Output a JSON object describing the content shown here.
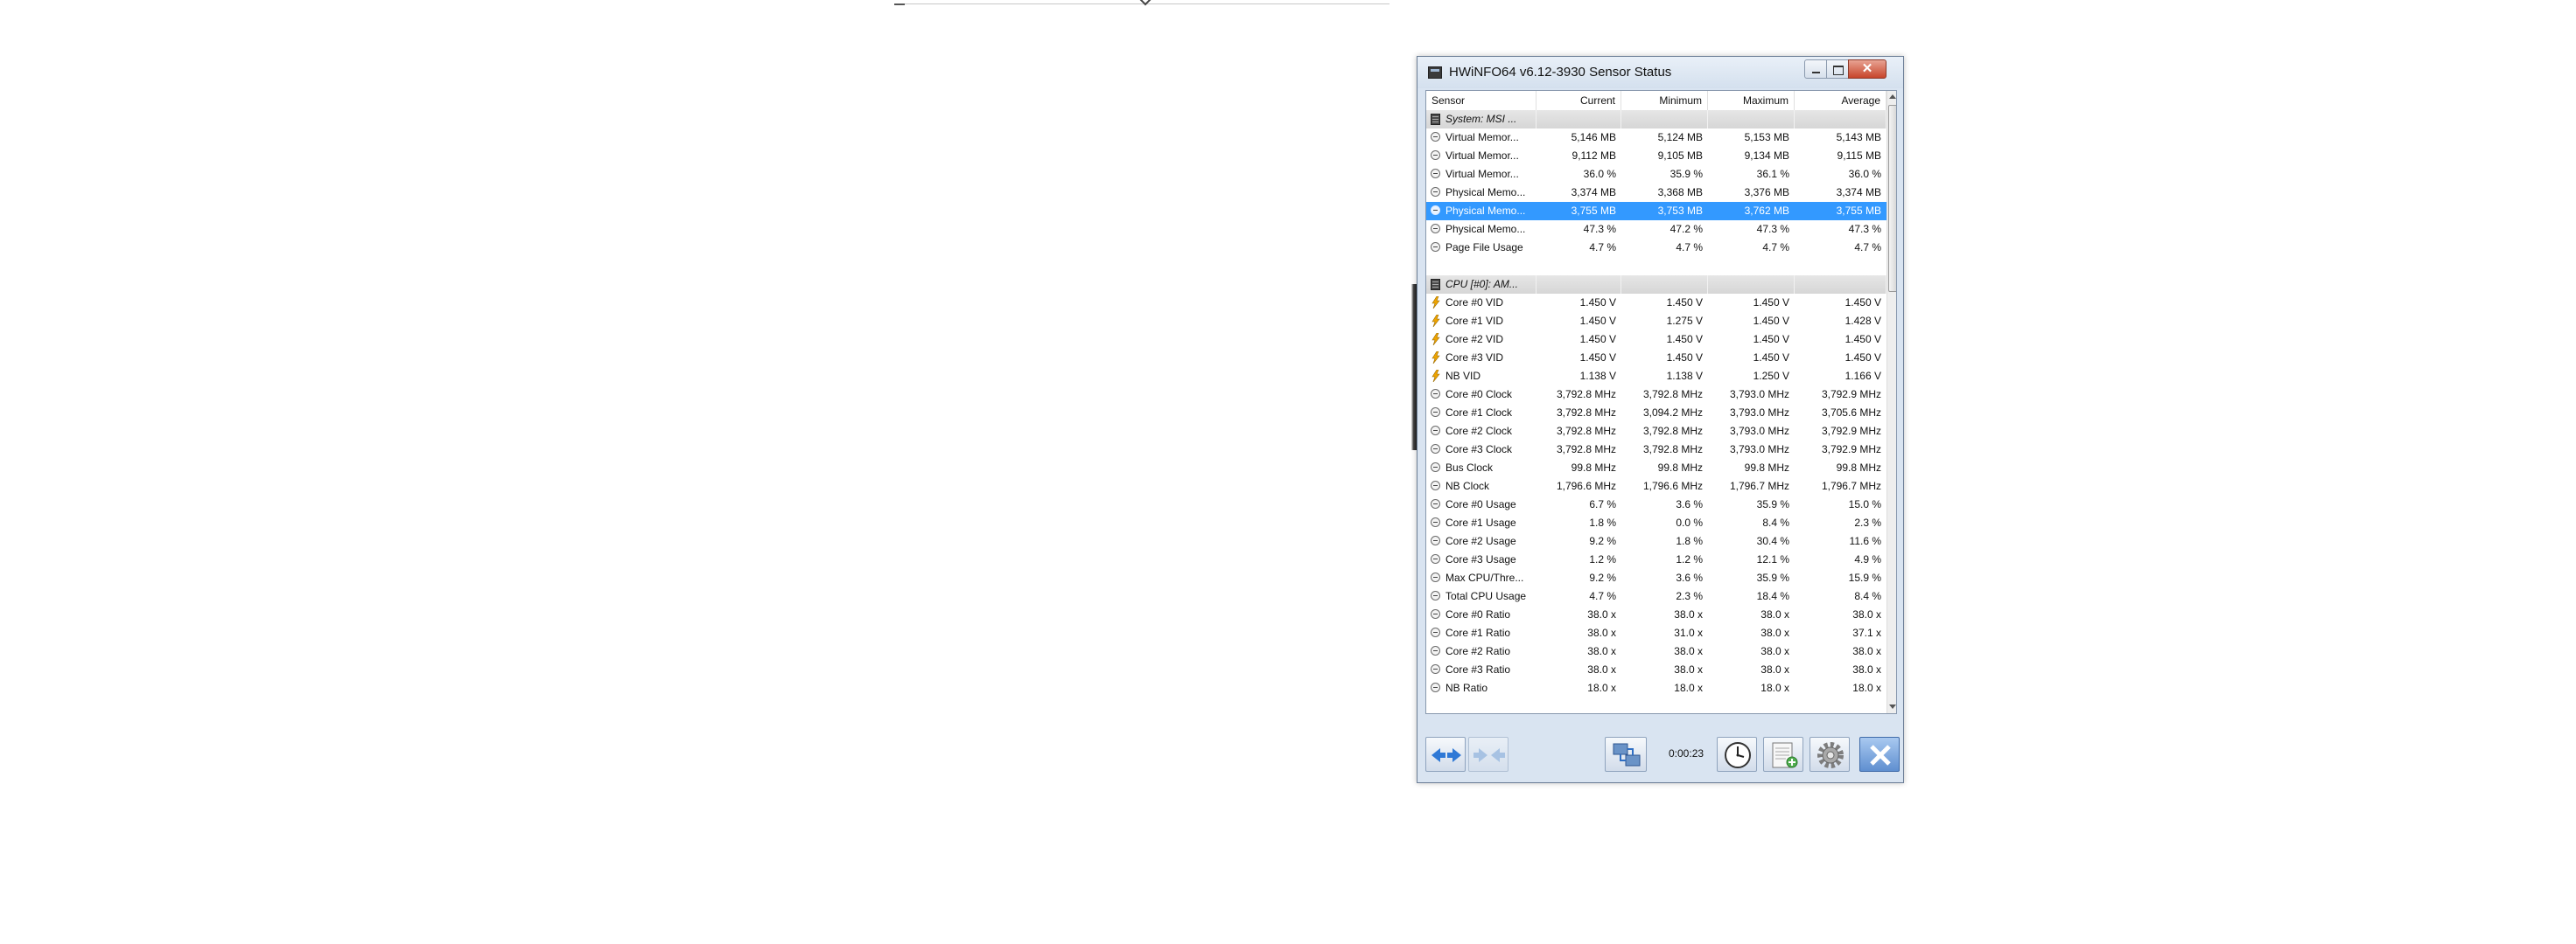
{
  "window": {
    "title": "HWiNFO64 v6.12-3930 Sensor Status"
  },
  "columns": {
    "sensor": "Sensor",
    "current": "Current",
    "minimum": "Minimum",
    "maximum": "Maximum",
    "average": "Average"
  },
  "rows": [
    {
      "type": "group",
      "name": "System: MSI ...",
      "icon": "chip-icon"
    },
    {
      "type": "data",
      "icon": "minus-icon",
      "name": "Virtual Memor...",
      "current": "5,146 MB",
      "minimum": "5,124 MB",
      "maximum": "5,153 MB",
      "average": "5,143 MB"
    },
    {
      "type": "data",
      "icon": "minus-icon",
      "name": "Virtual Memor...",
      "current": "9,112 MB",
      "minimum": "9,105 MB",
      "maximum": "9,134 MB",
      "average": "9,115 MB"
    },
    {
      "type": "data",
      "icon": "minus-icon",
      "name": "Virtual Memor...",
      "current": "36.0 %",
      "minimum": "35.9 %",
      "maximum": "36.1 %",
      "average": "36.0 %"
    },
    {
      "type": "data",
      "icon": "minus-icon",
      "name": "Physical Memo...",
      "current": "3,374 MB",
      "minimum": "3,368 MB",
      "maximum": "3,376 MB",
      "average": "3,374 MB"
    },
    {
      "type": "data",
      "icon": "minus-icon",
      "name": "Physical Memo...",
      "current": "3,755 MB",
      "minimum": "3,753 MB",
      "maximum": "3,762 MB",
      "average": "3,755 MB",
      "selected": true
    },
    {
      "type": "data",
      "icon": "minus-icon",
      "name": "Physical Memo...",
      "current": "47.3 %",
      "minimum": "47.2 %",
      "maximum": "47.3 %",
      "average": "47.3 %"
    },
    {
      "type": "data",
      "icon": "minus-icon",
      "name": "Page File Usage",
      "current": "4.7 %",
      "minimum": "4.7 %",
      "maximum": "4.7 %",
      "average": "4.7 %"
    },
    {
      "type": "blank"
    },
    {
      "type": "group",
      "name": "CPU [#0]: AM...",
      "icon": "chip-icon"
    },
    {
      "type": "data",
      "icon": "voltage-icon",
      "name": "Core #0 VID",
      "current": "1.450 V",
      "minimum": "1.450 V",
      "maximum": "1.450 V",
      "average": "1.450 V"
    },
    {
      "type": "data",
      "icon": "voltage-icon",
      "name": "Core #1 VID",
      "current": "1.450 V",
      "minimum": "1.275 V",
      "maximum": "1.450 V",
      "average": "1.428 V"
    },
    {
      "type": "data",
      "icon": "voltage-icon",
      "name": "Core #2 VID",
      "current": "1.450 V",
      "minimum": "1.450 V",
      "maximum": "1.450 V",
      "average": "1.450 V"
    },
    {
      "type": "data",
      "icon": "voltage-icon",
      "name": "Core #3 VID",
      "current": "1.450 V",
      "minimum": "1.450 V",
      "maximum": "1.450 V",
      "average": "1.450 V"
    },
    {
      "type": "data",
      "icon": "voltage-icon",
      "name": "NB VID",
      "current": "1.138 V",
      "minimum": "1.138 V",
      "maximum": "1.250 V",
      "average": "1.166 V"
    },
    {
      "type": "data",
      "icon": "minus-icon",
      "name": "Core #0 Clock",
      "current": "3,792.8 MHz",
      "minimum": "3,792.8 MHz",
      "maximum": "3,793.0 MHz",
      "average": "3,792.9 MHz"
    },
    {
      "type": "data",
      "icon": "minus-icon",
      "name": "Core #1 Clock",
      "current": "3,792.8 MHz",
      "minimum": "3,094.2 MHz",
      "maximum": "3,793.0 MHz",
      "average": "3,705.6 MHz"
    },
    {
      "type": "data",
      "icon": "minus-icon",
      "name": "Core #2 Clock",
      "current": "3,792.8 MHz",
      "minimum": "3,792.8 MHz",
      "maximum": "3,793.0 MHz",
      "average": "3,792.9 MHz"
    },
    {
      "type": "data",
      "icon": "minus-icon",
      "name": "Core #3 Clock",
      "current": "3,792.8 MHz",
      "minimum": "3,792.8 MHz",
      "maximum": "3,793.0 MHz",
      "average": "3,792.9 MHz"
    },
    {
      "type": "data",
      "icon": "minus-icon",
      "name": "Bus Clock",
      "current": "99.8 MHz",
      "minimum": "99.8 MHz",
      "maximum": "99.8 MHz",
      "average": "99.8 MHz"
    },
    {
      "type": "data",
      "icon": "minus-icon",
      "name": "NB Clock",
      "current": "1,796.6 MHz",
      "minimum": "1,796.6 MHz",
      "maximum": "1,796.7 MHz",
      "average": "1,796.7 MHz"
    },
    {
      "type": "data",
      "icon": "minus-icon",
      "name": "Core #0 Usage",
      "current": "6.7 %",
      "minimum": "3.6 %",
      "maximum": "35.9 %",
      "average": "15.0 %"
    },
    {
      "type": "data",
      "icon": "minus-icon",
      "name": "Core #1 Usage",
      "current": "1.8 %",
      "minimum": "0.0 %",
      "maximum": "8.4 %",
      "average": "2.3 %"
    },
    {
      "type": "data",
      "icon": "minus-icon",
      "name": "Core #2 Usage",
      "current": "9.2 %",
      "minimum": "1.8 %",
      "maximum": "30.4 %",
      "average": "11.6 %"
    },
    {
      "type": "data",
      "icon": "minus-icon",
      "name": "Core #3 Usage",
      "current": "1.2 %",
      "minimum": "1.2 %",
      "maximum": "12.1 %",
      "average": "4.9 %"
    },
    {
      "type": "data",
      "icon": "minus-icon",
      "name": "Max CPU/Thre...",
      "current": "9.2 %",
      "minimum": "3.6 %",
      "maximum": "35.9 %",
      "average": "15.9 %"
    },
    {
      "type": "data",
      "icon": "minus-icon",
      "name": "Total CPU Usage",
      "current": "4.7 %",
      "minimum": "2.3 %",
      "maximum": "18.4 %",
      "average": "8.4 %"
    },
    {
      "type": "data",
      "icon": "minus-icon",
      "name": "Core #0 Ratio",
      "current": "38.0 x",
      "minimum": "38.0 x",
      "maximum": "38.0 x",
      "average": "38.0 x"
    },
    {
      "type": "data",
      "icon": "minus-icon",
      "name": "Core #1 Ratio",
      "current": "38.0 x",
      "minimum": "31.0 x",
      "maximum": "38.0 x",
      "average": "37.1 x"
    },
    {
      "type": "data",
      "icon": "minus-icon",
      "name": "Core #2 Ratio",
      "current": "38.0 x",
      "minimum": "38.0 x",
      "maximum": "38.0 x",
      "average": "38.0 x"
    },
    {
      "type": "data",
      "icon": "minus-icon",
      "name": "Core #3 Ratio",
      "current": "38.0 x",
      "minimum": "38.0 x",
      "maximum": "38.0 x",
      "average": "38.0 x"
    },
    {
      "type": "data",
      "icon": "minus-icon",
      "name": "NB Ratio",
      "current": "18.0 x",
      "minimum": "18.0 x",
      "maximum": "18.0 x",
      "average": "18.0 x"
    }
  ],
  "toolbar": {
    "timer": "0:00:23"
  },
  "colors": {
    "selection": "#3399ff",
    "window_frame": "#d9e4f1",
    "close_button": "#c7452b"
  }
}
